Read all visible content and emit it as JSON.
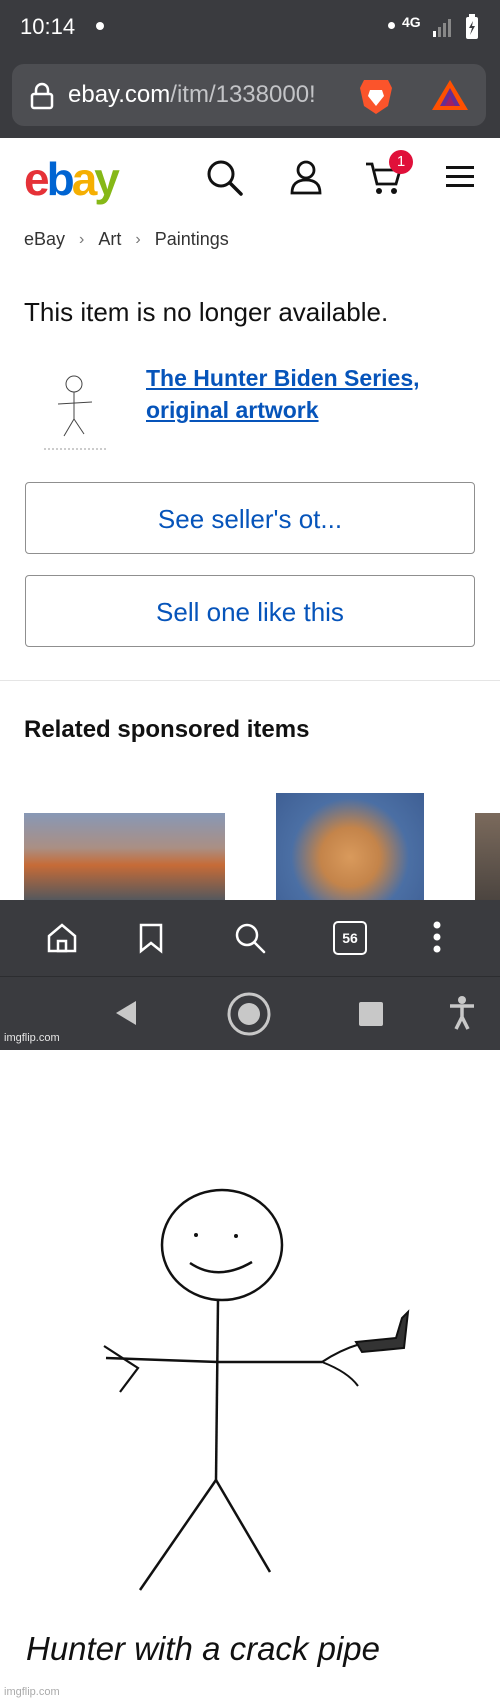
{
  "status_bar": {
    "time": "10:14",
    "network": "4G"
  },
  "browser": {
    "url_domain": "ebay.com",
    "url_path": "/itm/1338000!",
    "tab_count": "56"
  },
  "ebay": {
    "logo_letters": [
      "e",
      "b",
      "a",
      "y"
    ],
    "logo_colors": [
      "#e53238",
      "#0064d2",
      "#f5af02",
      "#86b817"
    ],
    "cart_count": "1",
    "breadcrumb": [
      "eBay",
      "Art",
      "Paintings"
    ],
    "unavailable_msg": "This item is no longer available.",
    "item_title": "The Hunter Biden Series, original artwork",
    "see_seller_label": "See seller's ot...",
    "sell_one_label": "Sell one like this",
    "related_heading": "Related sponsored items"
  },
  "watermark": "imgflip.com",
  "drawing": {
    "caption": "Hunter with a crack pipe"
  },
  "icons": [
    "lock-icon",
    "brave-icon",
    "bat-icon",
    "search-icon",
    "account-icon",
    "cart-icon",
    "menu-icon",
    "home-icon",
    "bookmark-icon",
    "tabs-icon",
    "more-icon",
    "back-icon",
    "home-nav-icon",
    "recents-icon",
    "accessibility-icon"
  ]
}
